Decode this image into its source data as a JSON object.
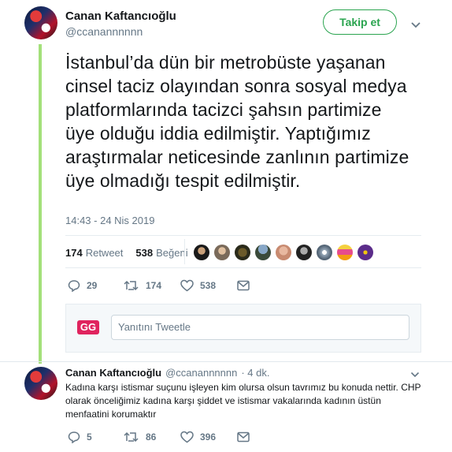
{
  "tweet": {
    "author_name": "Canan Kaftancıoğlu",
    "author_handle": "@ccanannnnnn",
    "follow_label": "Takip et",
    "text": "İstanbul’da dün bir metrobüste yaşanan cinsel taciz olayından sonra sosyal medya platformlarında  tacizci şahsın partimize üye olduğu iddia edilmiştir. Yaptığımız araştırmalar neticesinde zanlının partimize üye olmadığı tespit edilmiştir.",
    "timestamp": "14:43 - 24 Nis 2019",
    "retweets": "174",
    "retweets_label": "Retweet",
    "likes": "538",
    "likes_label": "Beğeni",
    "actions": {
      "reply": "29",
      "retweet": "174",
      "like": "538"
    }
  },
  "reply_box": {
    "logo": "GG",
    "placeholder": "Yanıtını Tweetle"
  },
  "reply": {
    "author_name": "Canan Kaftancıoğlu",
    "author_handle": "@ccanannnnnn",
    "time": "· 4 dk.",
    "text": "Kadına karşı istismar suçunu işleyen kim olursa olsun tavrımız bu konuda nettir. CHP olarak önceliğimiz kadına karşı şiddet ve istismar vakalarında kadının üstün menfaatini korumaktır",
    "actions": {
      "reply": "5",
      "retweet": "86",
      "like": "396"
    }
  },
  "colors": {
    "accent": "#2aa44f",
    "thread_line": "#a3e07a",
    "muted": "#657786"
  },
  "icons": [
    "chevron-down-icon",
    "reply-icon",
    "retweet-icon",
    "heart-icon",
    "dm-icon"
  ]
}
